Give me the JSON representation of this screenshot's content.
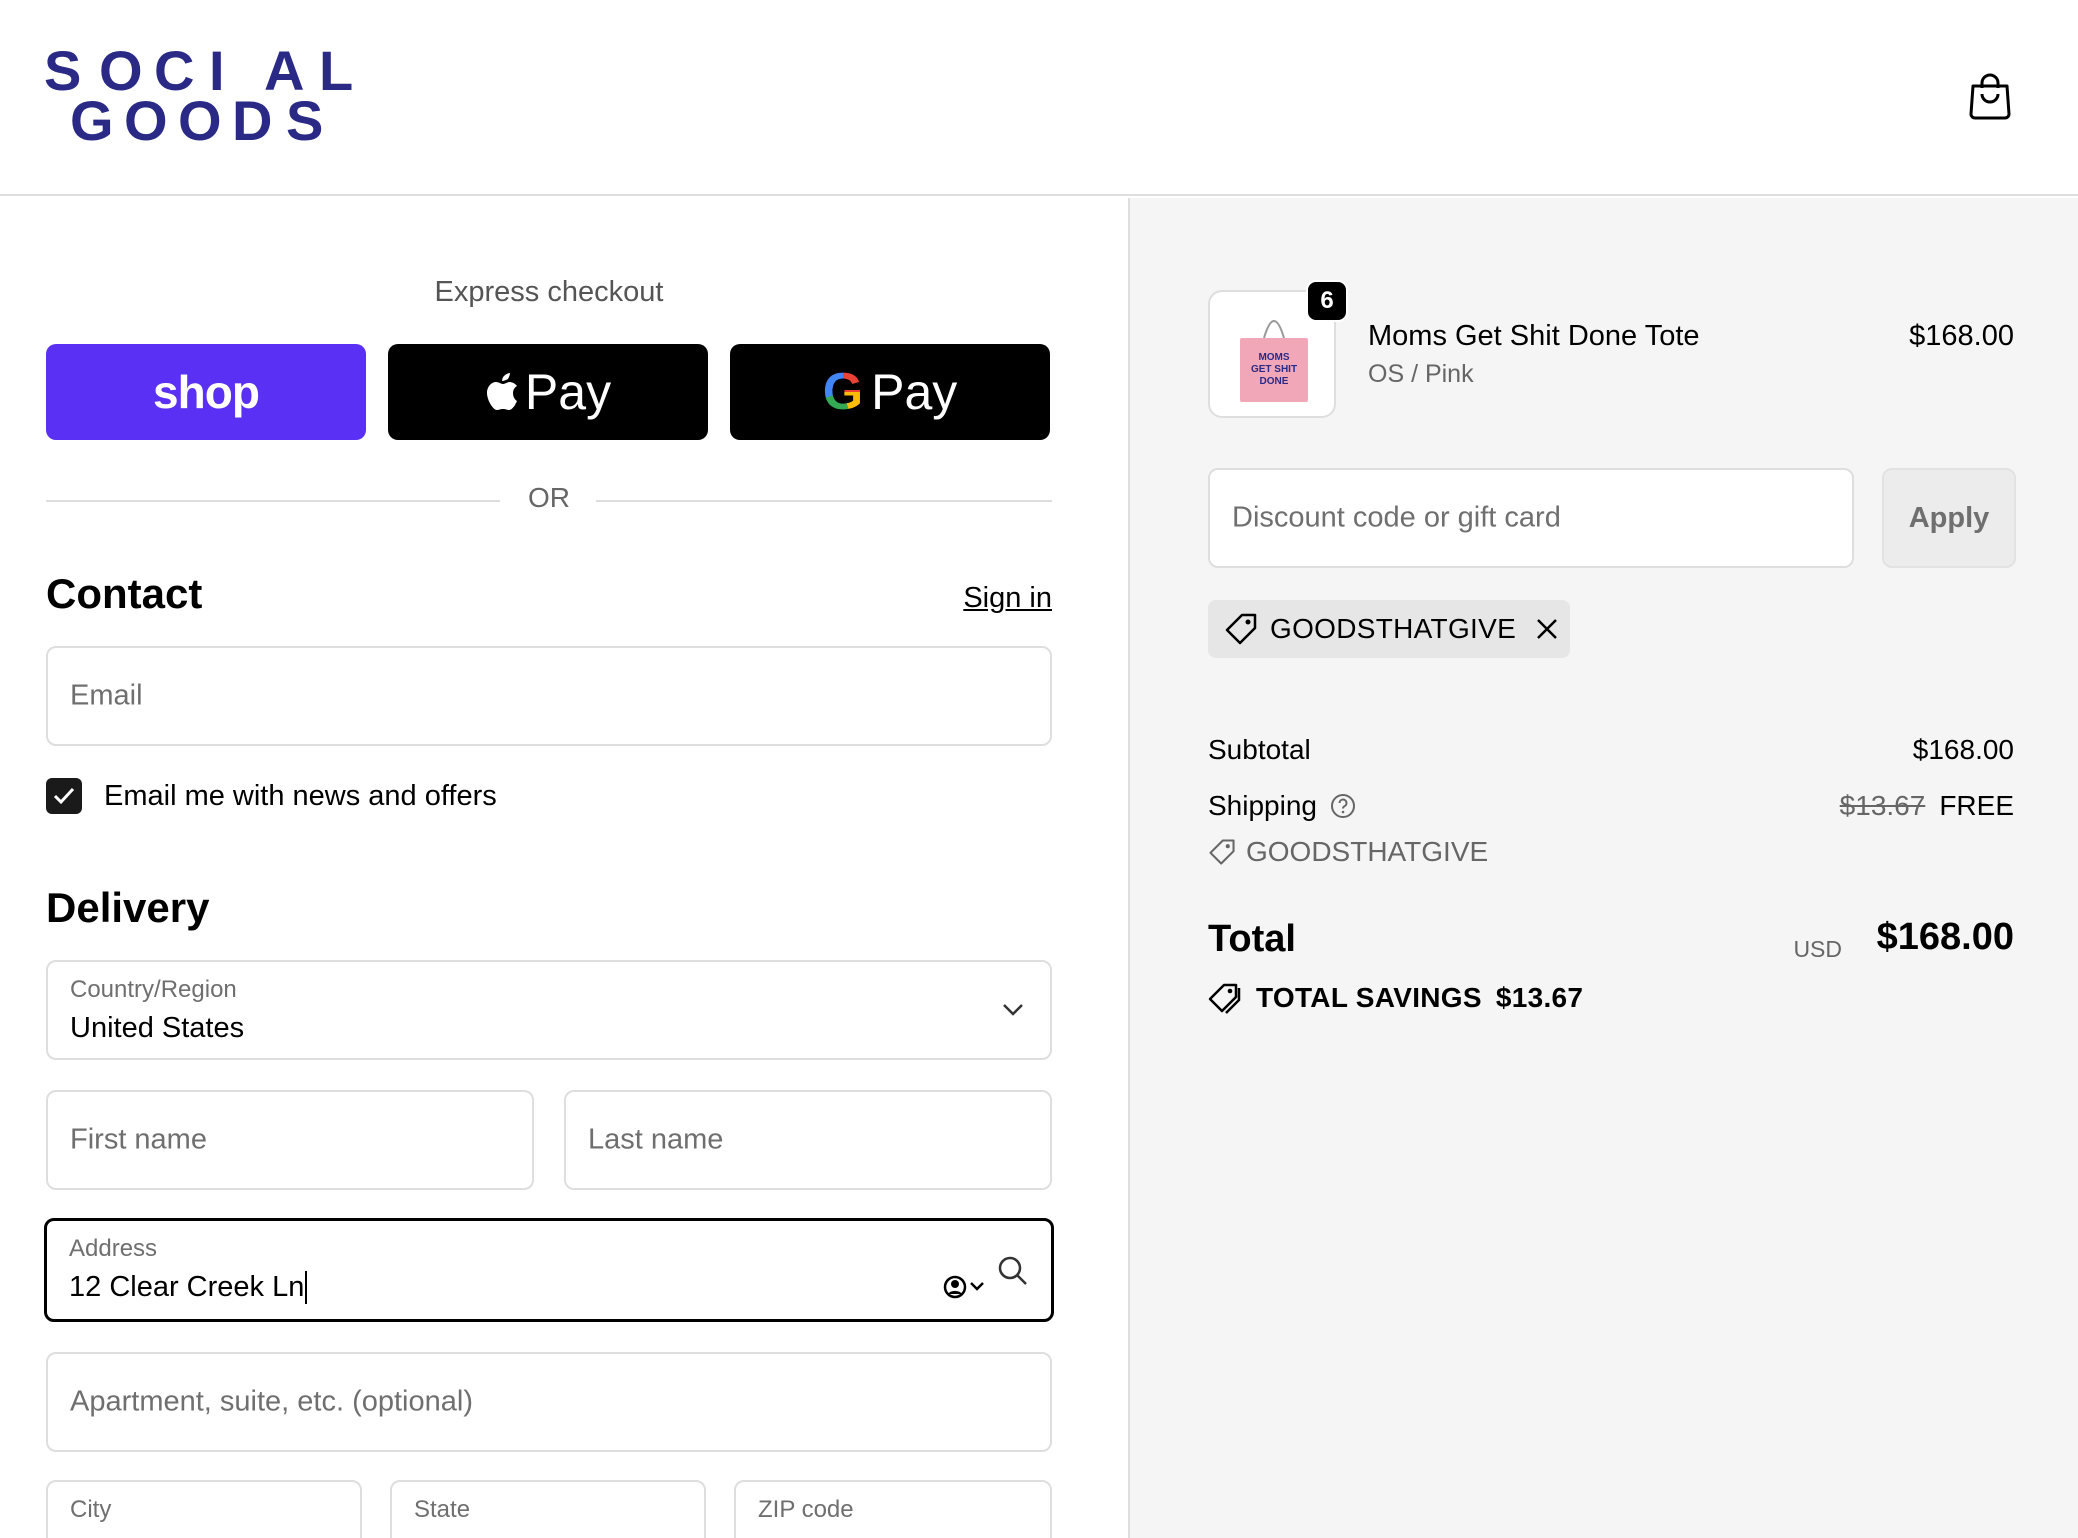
{
  "brand": {
    "logo_line1": [
      "S",
      "O",
      "C",
      "I",
      "A",
      "L"
    ],
    "logo_line2": [
      "G",
      "O",
      "O",
      "D",
      "S"
    ],
    "logo_color": "#2a2a86"
  },
  "header": {
    "cart_icon": "shopping-bag-icon"
  },
  "express": {
    "title": "Express checkout",
    "shop_label": "shop",
    "apple_label": "Pay",
    "google_label": "Pay",
    "shop_color": "#5a31f4",
    "or_text": "OR"
  },
  "contact": {
    "title": "Contact",
    "sign_in": "Sign in",
    "email_placeholder": "Email",
    "newsletter_label": "Email me with news and offers",
    "newsletter_checked": true
  },
  "delivery": {
    "title": "Delivery",
    "country_label": "Country/Region",
    "country_value": "United States",
    "first_name_placeholder": "First name",
    "last_name_placeholder": "Last name",
    "address_label": "Address",
    "address_value": "12 Clear Creek Ln",
    "apartment_placeholder": "Apartment, suite, etc. (optional)",
    "city_label": "City",
    "state_label": "State",
    "zip_label": "ZIP code"
  },
  "order": {
    "item": {
      "name": "Moms Get Shit Done Tote",
      "variant": "OS / Pink",
      "price": "$168.00",
      "quantity": "6",
      "thumb_text": [
        "MOMS",
        "GET SHIT",
        "DONE"
      ]
    },
    "discount_placeholder": "Discount code or gift card",
    "apply_label": "Apply",
    "applied_code": "GOODSTHATGIVE",
    "subtotal_label": "Subtotal",
    "subtotal_value": "$168.00",
    "shipping_label": "Shipping",
    "shipping_original": "$13.67",
    "shipping_value": "FREE",
    "shipping_code": "GOODSTHATGIVE",
    "total_label": "Total",
    "currency": "USD",
    "total_value": "$168.00",
    "savings_label": "TOTAL SAVINGS",
    "savings_value": "$13.67"
  }
}
